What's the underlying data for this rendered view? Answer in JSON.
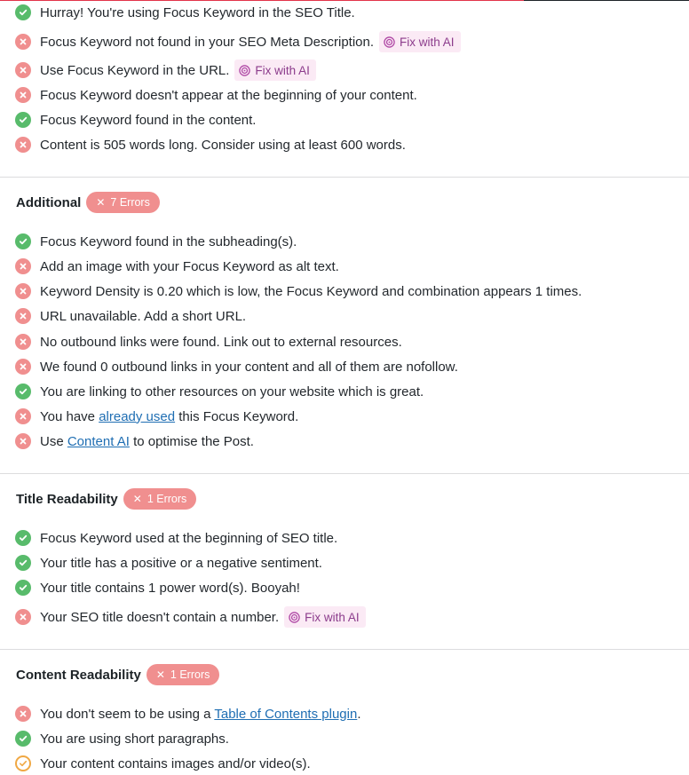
{
  "basic": {
    "items": [
      {
        "status": "ok",
        "text": "Hurray! You're using Focus Keyword in the SEO Title."
      },
      {
        "status": "err",
        "text": "Focus Keyword not found in your SEO Meta Description.",
        "fix": "Fix with AI"
      },
      {
        "status": "err",
        "text": "Use Focus Keyword in the URL.",
        "fix": "Fix with AI"
      },
      {
        "status": "err",
        "text": "Focus Keyword doesn't appear at the beginning of your content."
      },
      {
        "status": "ok",
        "text": "Focus Keyword found in the content."
      },
      {
        "status": "err",
        "text": "Content is 505 words long. Consider using at least 600 words."
      }
    ]
  },
  "additional": {
    "title": "Additional",
    "badge": "7 Errors",
    "items": [
      {
        "status": "ok",
        "text": "Focus Keyword found in the subheading(s)."
      },
      {
        "status": "err",
        "text": "Add an image with your Focus Keyword as alt text."
      },
      {
        "status": "err",
        "text": "Keyword Density is 0.20 which is low, the Focus Keyword and combination appears 1 times."
      },
      {
        "status": "err",
        "text": "URL unavailable. Add a short URL."
      },
      {
        "status": "err",
        "text": "No outbound links were found. Link out to external resources."
      },
      {
        "status": "err",
        "text": "We found 0 outbound links in your content and all of them are nofollow."
      },
      {
        "status": "ok",
        "text": "You are linking to other resources on your website which is great."
      },
      {
        "status": "err",
        "pre": "You have ",
        "link": "already used",
        "post": " this Focus Keyword."
      },
      {
        "status": "err",
        "pre": "Use ",
        "link": "Content AI",
        "post": " to optimise the Post."
      }
    ]
  },
  "title_readability": {
    "title": "Title Readability",
    "badge": "1 Errors",
    "items": [
      {
        "status": "ok",
        "text": "Focus Keyword used at the beginning of SEO title."
      },
      {
        "status": "ok",
        "text": "Your title has a positive or a negative sentiment."
      },
      {
        "status": "ok",
        "text": "Your title contains 1 power word(s). Booyah!"
      },
      {
        "status": "err",
        "text": "Your SEO title doesn't contain a number.",
        "fix": "Fix with AI"
      }
    ]
  },
  "content_readability": {
    "title": "Content Readability",
    "badge": "1 Errors",
    "items": [
      {
        "status": "err",
        "pre": "You don't seem to be using a ",
        "link": "Table of Contents plugin",
        "post": "."
      },
      {
        "status": "ok",
        "text": "You are using short paragraphs."
      },
      {
        "status": "warn",
        "text": "Your content contains images and/or video(s)."
      }
    ]
  },
  "colors": {
    "ok": "#58bb6b",
    "err": "#f08f8f",
    "warn": "#f0a844",
    "badge": "#f08f8f",
    "link": "#1f6eb3",
    "fix_bg": "#fbeaf5",
    "fix_text": "#8c3c8c"
  }
}
